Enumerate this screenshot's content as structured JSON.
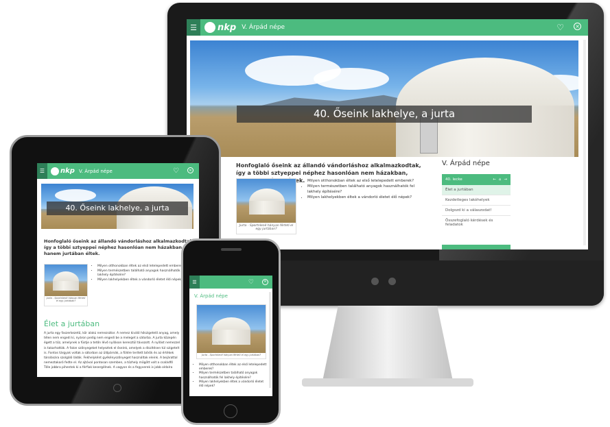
{
  "app": {
    "logo_text": "nkp",
    "title": "V. Árpád népe"
  },
  "lesson": {
    "banner": "40. Őseink lakhelye, a jurta",
    "intro": "Honfoglaló őseink az állandó vándorláshoz alkalmazkodtak, így a többi sztyeppei néphez hasonlóan nem házakban, hanem jurtában éltek.",
    "image_caption": "Jurta - Sportnlené hányan férteti el egy jurtában?",
    "questions": [
      "Milyen otthonokban éltek az első letelepedett emberek?",
      "Milyen természetben található anyagok használhatók fel lakhely építésére?",
      "Milyen lakhelyekben éltek a vándorló életet élő népek?"
    ],
    "section_heading": "Élet a jurtában",
    "body_text": [
      "A jurta egy faszerkezetű, kör alakú nemezsátor. A nemez kiváló hőszigetelő anyag, amely",
      "télen nem engedi ki, nyáron pedig nem engedi be a meleget a sátorba. A jurta közepén",
      "égett a tűz, amelynek a füstje a tetőn lévő nyíláson keresztül távozott. A nyílást nemezzel",
      "is takarhatták. A falon szőnyegeket helyeztek el őseink, amelyek a díszítésen túl szigetelt",
      "is. Fontos tárgyak voltak a sátorban az ülőpárnák, a földre terített bőrök és az értékek",
      "tárolására szolgáló ládák. Fekhelyként gyékényszőnyeget használtak eleink. A bejárattal",
      "nemeztakaró fedte el. Az ajtóval pontosan szemben, a tűzhely mögött volt a családfő",
      "Tőle jobbra pihentek ki a férfiak kesergélnek. A vagyon és a fegyverek is jobb oldalra"
    ]
  },
  "sidebar": {
    "title": "V. Árpád népe",
    "nav_label": "40. lecke",
    "nav_arrows": [
      "←",
      "⌂",
      "→"
    ],
    "items": [
      "Élet a jurtában",
      "Kezdetleges lakóhelyek",
      "Dolgozd ki a válaszodat!",
      "Összefoglaló kérdések és feladatok"
    ]
  },
  "icons": {
    "menu": "list-icon",
    "favorite": "heart-icon",
    "close": "close-circle-icon"
  },
  "colors": {
    "accent": "#4cbb7f",
    "accent_dark": "#2e7f58"
  }
}
